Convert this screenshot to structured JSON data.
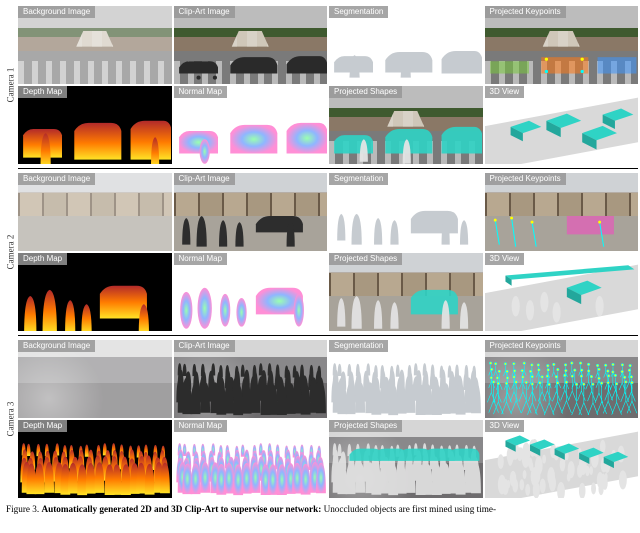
{
  "cameras": [
    {
      "label": "Camera 1"
    },
    {
      "label": "Camera 2"
    },
    {
      "label": "Camera 3"
    }
  ],
  "panel_labels": {
    "background": "Background Image",
    "clipart": "Clip-Art Image",
    "segmentation": "Segmentation",
    "keypoints": "Projected Keypoints",
    "depth": "Depth Map",
    "normal": "Normal Map",
    "shapes": "Projected Shapes",
    "view3d": "3D View"
  },
  "caption": {
    "figure_number": "Figure 3.",
    "title": "Automatically generated 2D and 3D Clip-Art to supervise our network:",
    "body": "Unoccluded objects are first mined using time-"
  },
  "seg_palette": {
    "car": "#9aa0a6",
    "person": "#b7bcc2"
  },
  "depth_palette": {
    "near": "#ffe326",
    "mid": "#ff7b00",
    "far": "#b22a2a"
  },
  "normal_palette": {
    "n1": "#8fb6ff",
    "n2": "#ff8fd6",
    "n3": "#9affb0",
    "n4": "#d6a3ff"
  },
  "shape_palette": {
    "car": "#2fd3c5",
    "person": "#e4e4e4"
  }
}
